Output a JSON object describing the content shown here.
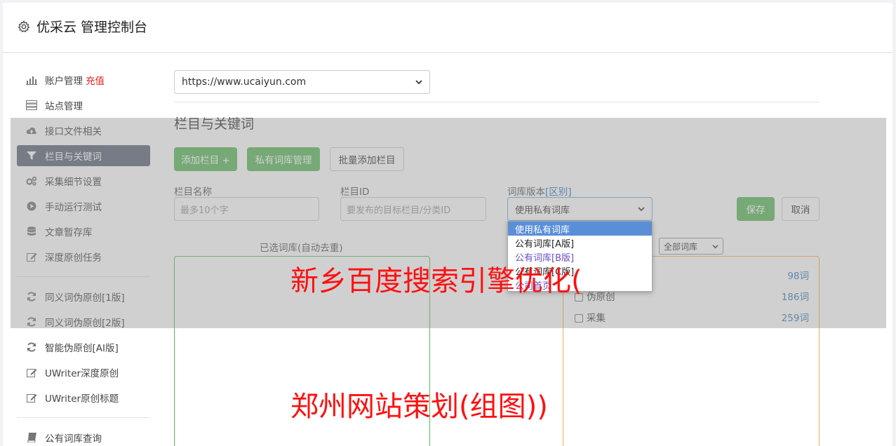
{
  "header": {
    "title": "优采云 管理控制台",
    "icon": "gear-icon"
  },
  "sidebar": {
    "items": [
      {
        "label": "账户管理",
        "extra": "充值",
        "icon": "bar-chart-icon"
      },
      {
        "label": "站点管理",
        "icon": "server-icon"
      },
      {
        "label": "接口文件相关",
        "icon": "cloud-upload-icon"
      },
      {
        "label": "栏目与关键词",
        "icon": "filter-icon",
        "active": true
      },
      {
        "label": "采集细节设置",
        "icon": "cogs-icon"
      },
      {
        "label": "手动运行测试",
        "icon": "play-circle-icon"
      },
      {
        "label": "文章暂存库",
        "icon": "database-icon"
      },
      {
        "label": "深度原创任务",
        "icon": "edit-icon"
      },
      {
        "label": "同义词伪原创[1版]",
        "icon": "refresh-icon"
      },
      {
        "label": "同义词伪原创[2版]",
        "icon": "refresh-icon"
      },
      {
        "label": "智能伪原创[AI版]",
        "icon": "refresh-icon"
      },
      {
        "label": "UWriter深度原创",
        "icon": "edit-icon"
      },
      {
        "label": "UWriter原创标题",
        "icon": "edit-icon"
      },
      {
        "label": "公有词库查询",
        "icon": "book-icon"
      }
    ],
    "accent": "#e02020",
    "active_bg": "#5b6777"
  },
  "main": {
    "site_select": "https://www.ucaiyun.com",
    "section_title": "栏目与关键词",
    "buttons": {
      "add_column": "添加栏目 +",
      "private_lib": "私有词库管理",
      "batch_add": "批量添加栏目",
      "save": "保存",
      "cancel": "取消"
    },
    "form": {
      "name_label": "栏目名称",
      "name_placeholder": "最多10个字",
      "id_label": "栏目ID",
      "id_placeholder": "要发布的目标栏目/分类ID",
      "version_label": "词库版本",
      "version_link": "[区别]",
      "version_value": "使用私有词库"
    },
    "dropdown_options": [
      "使用私有词库",
      "公有词库[A版]",
      "公有词库[B版]",
      "公有词库[C版]",
      "公司首页"
    ],
    "left_panel_caption": "已选词库(自动去重)",
    "right_filter": "全部词库",
    "libs": [
      {
        "name": "",
        "count": "98词"
      },
      {
        "name": "伪原创",
        "count": "186词"
      },
      {
        "name": "采集",
        "count": "259词"
      }
    ]
  },
  "watermarks": {
    "line1": "新乡百度搜索引擎优化(",
    "line2": "郑州网站策划(组图))"
  },
  "colors": {
    "green": "#5cb85c",
    "orange": "#f0ad4e",
    "link": "#337ab7",
    "watermark": "#ff1010"
  }
}
